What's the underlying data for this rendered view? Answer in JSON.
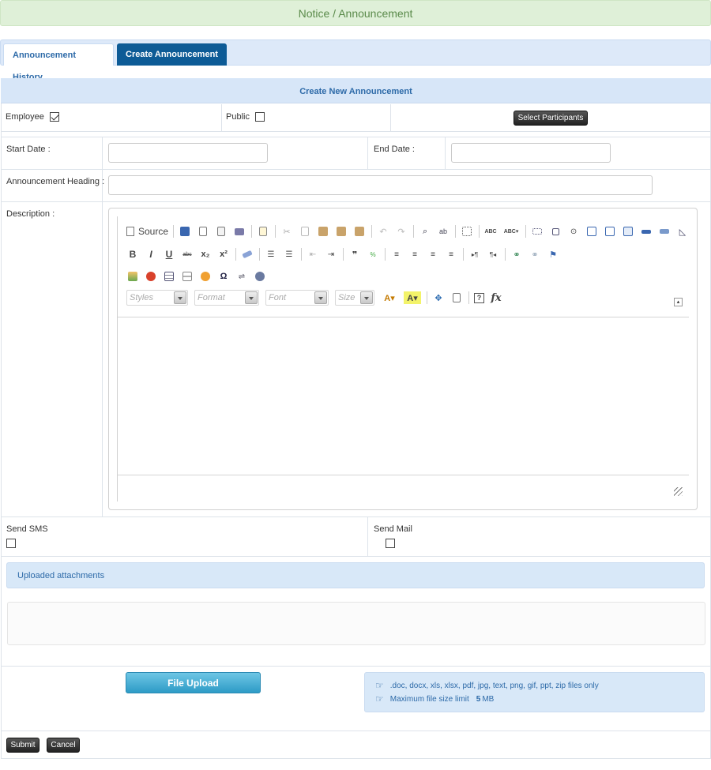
{
  "header": {
    "title": "Notice / Announcement"
  },
  "tabs": [
    {
      "label": "Announcement History"
    },
    {
      "label": "Create Announcement"
    }
  ],
  "form": {
    "title": "Create New Announcement",
    "employee_label": "Employee",
    "employee_checked": true,
    "public_label": "Public",
    "public_checked": false,
    "select_participants_label": "Select Participants",
    "start_date_label": "Start Date :",
    "start_date_value": "",
    "end_date_label": "End Date :",
    "end_date_value": "",
    "heading_label": "Announcement Heading :",
    "heading_value": "",
    "description_label": "Description :",
    "send_sms_label": "Send SMS",
    "send_mail_label": "Send Mail"
  },
  "editor": {
    "source_label": "Source",
    "styles_label": "Styles",
    "format_label": "Format",
    "font_label": "Font",
    "size_label": "Size"
  },
  "attachments": {
    "title": "Uploaded attachments",
    "upload_label": "File Upload",
    "allowed_types": ".doc, docx, xls, xlsx, pdf, jpg, text, png, gif, ppt, zip files only",
    "size_limit_label": "Maximum file size limit",
    "size_limit_value": "5",
    "size_limit_unit": "MB"
  },
  "actions": {
    "submit_label": "Submit",
    "cancel_label": "Cancel"
  },
  "colors": {
    "accent": "#0d5b96",
    "notice_bg": "#dff0d8",
    "panel_bg": "#d8e8f8"
  }
}
